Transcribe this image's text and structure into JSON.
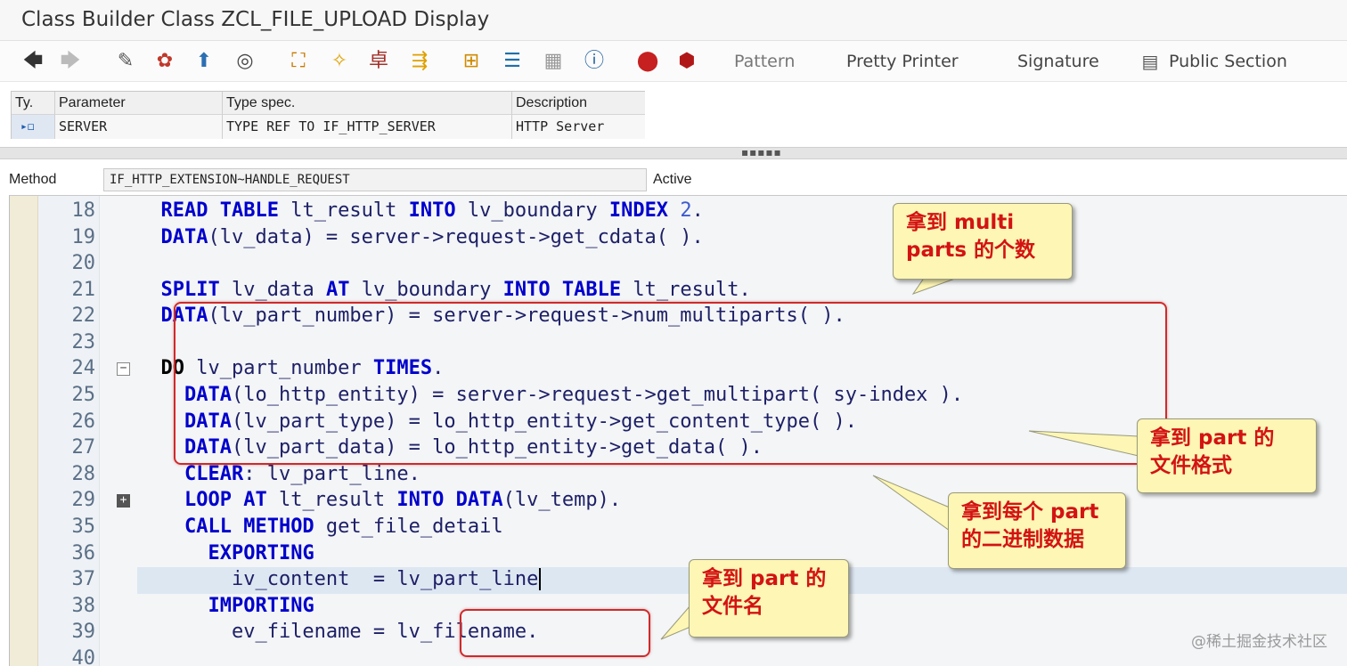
{
  "window": {
    "title": "Class Builder Class ZCL_FILE_UPLOAD Display"
  },
  "toolbar": {
    "icons": [
      "back-arrow-icon",
      "forward-arrow-icon",
      "display-change-icon",
      "object-list-icon",
      "activate-icon",
      "where-used-icon",
      "other-object-icon",
      "wand-icon",
      "test-icon",
      "toggle-icon",
      "hierarchy-icon",
      "stack-icon",
      "grid-icon",
      "info-icon",
      "breakpoint-icon",
      "session-breakpoint-icon"
    ],
    "pattern": "Pattern",
    "pretty_printer": "Pretty Printer",
    "signature": "Signature",
    "public_section": "Public Section"
  },
  "params": {
    "headers": [
      "Ty.",
      "Parameter",
      "Type spec.",
      "Description"
    ],
    "row": {
      "type_icon": "▸◻",
      "parameter": "SERVER",
      "type_spec": "TYPE REF TO IF_HTTP_SERVER",
      "description": "HTTP Server"
    }
  },
  "splitter": {
    "grip": "▪▪▪▪▪"
  },
  "method": {
    "label": "Method",
    "value": "IF_HTTP_EXTENSION~HANDLE_REQUEST",
    "status": "Active"
  },
  "code_lines": [
    {
      "n": "18"
    },
    {
      "n": "19"
    },
    {
      "n": "20"
    },
    {
      "n": "21"
    },
    {
      "n": "22"
    },
    {
      "n": "23"
    },
    {
      "n": "24"
    },
    {
      "n": "25"
    },
    {
      "n": "26"
    },
    {
      "n": "27"
    },
    {
      "n": "28"
    },
    {
      "n": "29"
    },
    {
      "n": "35"
    },
    {
      "n": "36"
    },
    {
      "n": "37"
    },
    {
      "n": "38"
    },
    {
      "n": "39"
    },
    {
      "n": "40"
    }
  ],
  "fold_icons": {
    "collapse": "−",
    "expand": "+"
  },
  "callouts": {
    "multiparts": [
      "拿到 multi",
      "parts 的个数"
    ],
    "content_type": [
      "拿到 part 的",
      "文件格式"
    ],
    "binary": [
      "拿到每个 part",
      "的二进制数据"
    ],
    "filename": [
      "拿到 part 的",
      "文件名"
    ]
  },
  "watermark": "@稀土掘金技术社区",
  "colors": {
    "keyword": "#0000cc",
    "highlight_box": "#cf2a2a",
    "callout_bg": "#fdf6b5",
    "callout_text": "#d31313"
  }
}
